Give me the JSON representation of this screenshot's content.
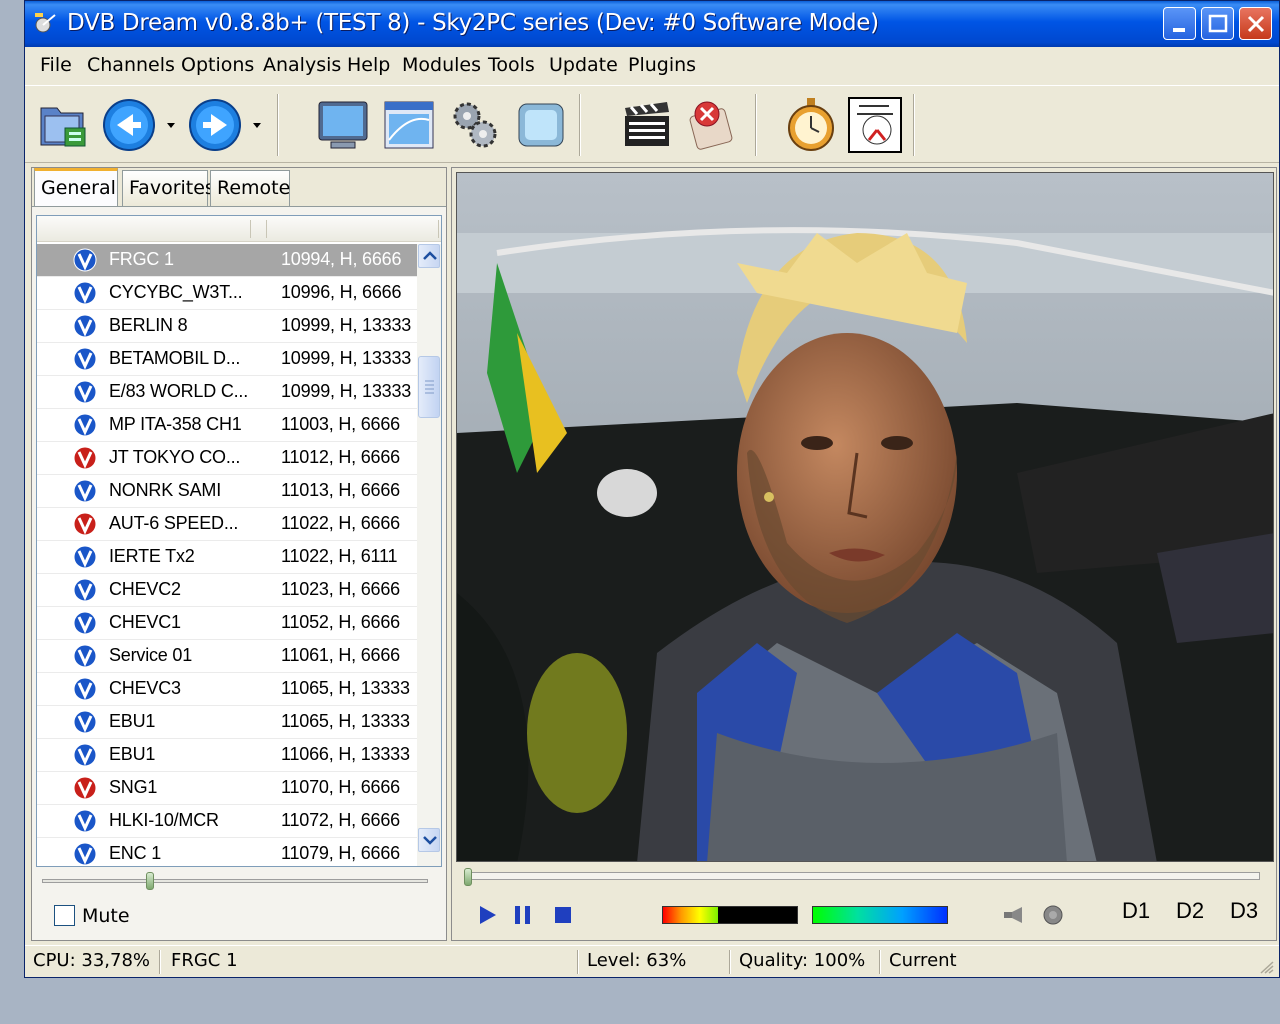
{
  "window": {
    "title": "DVB Dream v0.8.8b+ (TEST 8) - Sky2PC series (Dev: #0 Software Mode)"
  },
  "menu": [
    "File",
    "Channels",
    "Options",
    "Analysis",
    "Help",
    "Modules",
    "Tools",
    "Update",
    "Plugins"
  ],
  "toolbar": {
    "icons": [
      "open-folder-icon",
      "back-icon",
      "forward-icon",
      "monitor-icon",
      "spectrum-window-icon",
      "settings-gears-icon",
      "screenshot-icon",
      "clapperboard-icon",
      "stop-record-icon",
      "stopwatch-icon",
      "clock-schedule-icon"
    ]
  },
  "tabs": [
    "General",
    "Favorites",
    "Remote"
  ],
  "channels": [
    {
      "name": "FRGC 1",
      "freq": "10994, H, 6666",
      "icon": "blue",
      "selected": true
    },
    {
      "name": "CYCYBC_W3T...",
      "freq": "10996, H, 6666",
      "icon": "blue"
    },
    {
      "name": "BERLIN 8",
      "freq": "10999, H, 13333",
      "icon": "blue"
    },
    {
      "name": "BETAMOBIL D...",
      "freq": "10999, H, 13333",
      "icon": "blue"
    },
    {
      "name": "E/83 WORLD C...",
      "freq": "10999, H, 13333",
      "icon": "blue"
    },
    {
      "name": "MP ITA-358 CH1",
      "freq": "11003, H, 6666",
      "icon": "blue"
    },
    {
      "name": "JT TOKYO CO...",
      "freq": "11012, H, 6666",
      "icon": "red"
    },
    {
      "name": "NONRK SAMI",
      "freq": "11013, H, 6666",
      "icon": "blue"
    },
    {
      "name": "AUT-6 SPEED...",
      "freq": "11022, H, 6666",
      "icon": "red"
    },
    {
      "name": "IERTE Tx2",
      "freq": "11022, H, 6111",
      "icon": "blue"
    },
    {
      "name": "CHEVC2",
      "freq": "11023, H, 6666",
      "icon": "blue"
    },
    {
      "name": "CHEVC1",
      "freq": "11052, H, 6666",
      "icon": "blue"
    },
    {
      "name": "Service 01",
      "freq": "11061, H, 6666",
      "icon": "blue"
    },
    {
      "name": "CHEVC3",
      "freq": "11065, H, 13333",
      "icon": "blue"
    },
    {
      "name": "EBU1",
      "freq": "11065, H, 13333",
      "icon": "blue"
    },
    {
      "name": "EBU1",
      "freq": "11066, H, 13333",
      "icon": "blue"
    },
    {
      "name": "SNG1",
      "freq": "11070, H, 6666",
      "icon": "red"
    },
    {
      "name": "HLKI-10/MCR",
      "freq": "11072, H, 6666",
      "icon": "blue"
    },
    {
      "name": "ENC 1",
      "freq": "11079, H, 6666",
      "icon": "blue"
    }
  ],
  "volume": {
    "level": 0.27
  },
  "mute": {
    "label": "Mute",
    "checked": false
  },
  "player": {
    "seek_position": 0.0,
    "level_fraction": 0.63,
    "quality_fraction": 1.0,
    "d_buttons": [
      "D1",
      "D2",
      "D3"
    ]
  },
  "status": {
    "cpu": "CPU: 33,78%",
    "channel": "FRGC 1",
    "level": "Level: 63%",
    "quality": "Quality: 100%",
    "mode": "Current"
  },
  "colors": {
    "title_blue": "#0055e5",
    "selected_row": "#a6a6a6",
    "channel_icon_blue": "#1a56c8",
    "channel_icon_red": "#c8201a"
  }
}
